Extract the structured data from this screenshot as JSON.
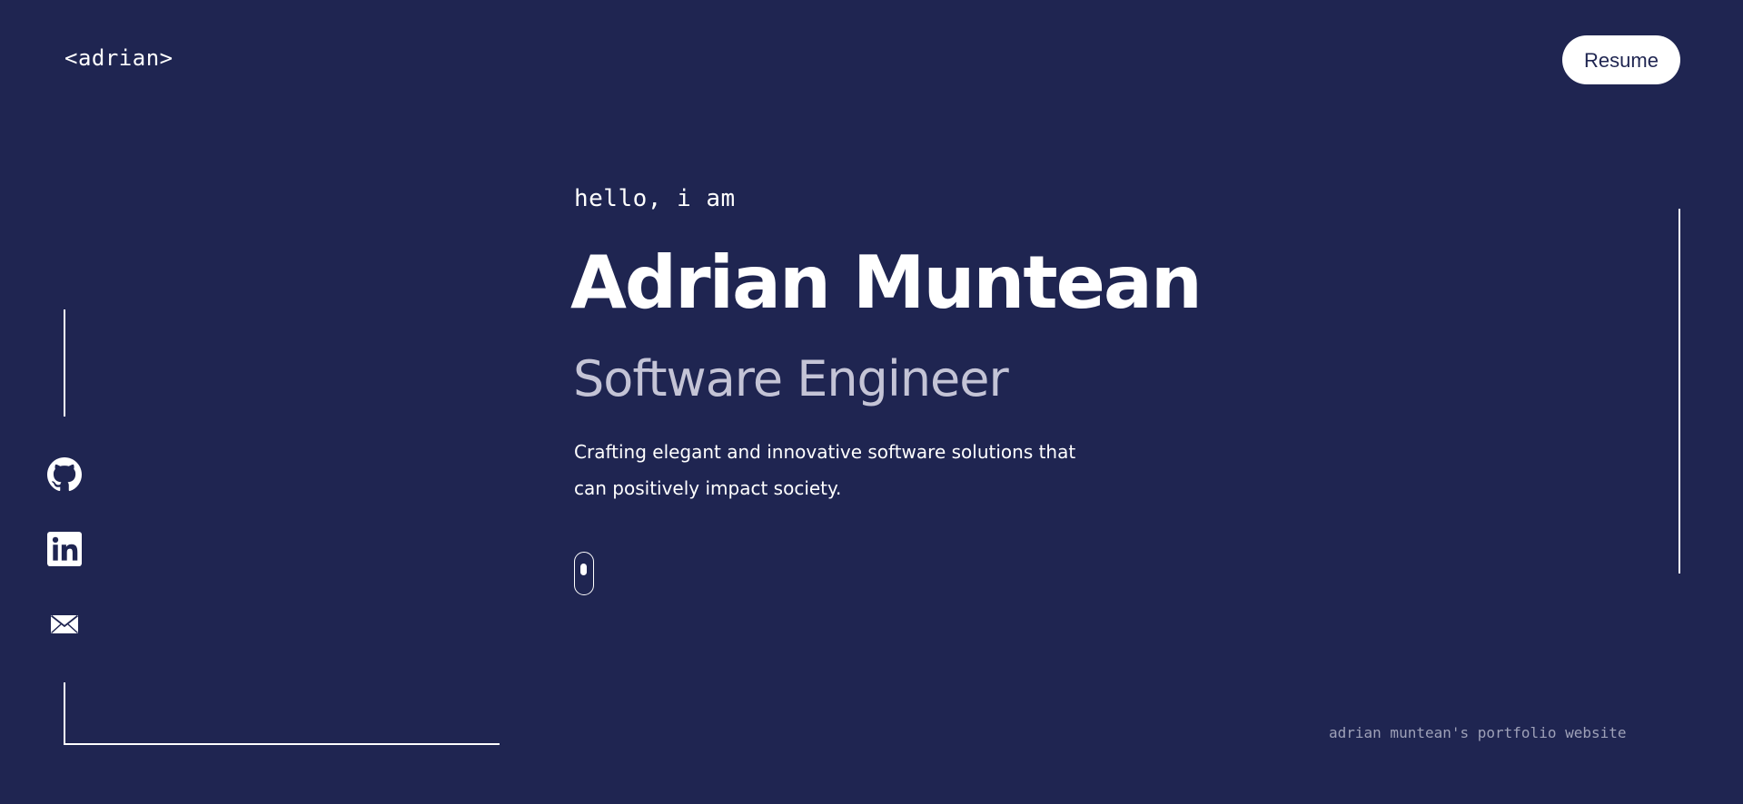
{
  "header": {
    "logo_text": "<adrian>",
    "resume_label": "Resume"
  },
  "hero": {
    "greeting": "hello, i am",
    "name": "Adrian Muntean",
    "role": "Software Engineer",
    "tagline": "Crafting elegant and innovative software solutions that can positively impact society."
  },
  "social": {
    "items": [
      {
        "icon": "github-icon"
      },
      {
        "icon": "linkedin-icon"
      },
      {
        "icon": "mail-icon"
      }
    ]
  },
  "footer": {
    "note": "adrian muntean's portfolio website"
  },
  "colors": {
    "background": "#1f2551",
    "text": "#ffffff",
    "muted": "#c4c4d6",
    "footer": "#9ea1b8"
  }
}
